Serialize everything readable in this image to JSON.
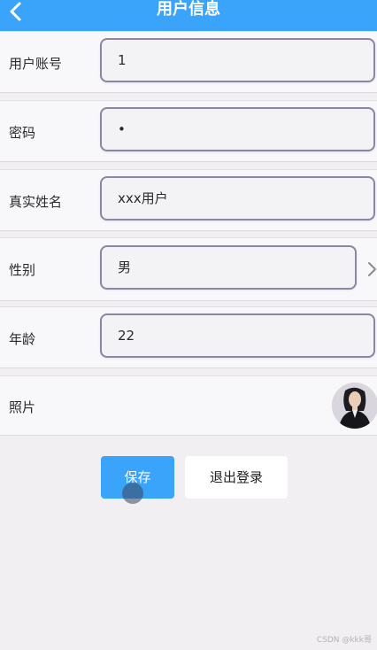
{
  "header": {
    "title": "用户信息",
    "back_icon": "chevron-left-icon"
  },
  "form": {
    "account": {
      "label": "用户账号",
      "value": "1"
    },
    "password": {
      "label": "密码",
      "value": "•"
    },
    "real_name": {
      "label": "真实姓名",
      "value": "xxx用户"
    },
    "gender": {
      "label": "性别",
      "value": "男",
      "chevron_icon": "chevron-right-icon"
    },
    "age": {
      "label": "年龄",
      "value": "22"
    },
    "photo": {
      "label": "照片",
      "avatar": "user-avatar"
    }
  },
  "actions": {
    "save_label": "保存",
    "logout_label": "退出登录"
  },
  "watermark": "CSDN @kkk哥",
  "colors": {
    "accent": "#3aa3fa",
    "page_bg": "#f1eff2",
    "field_border": "#8a86a3"
  }
}
